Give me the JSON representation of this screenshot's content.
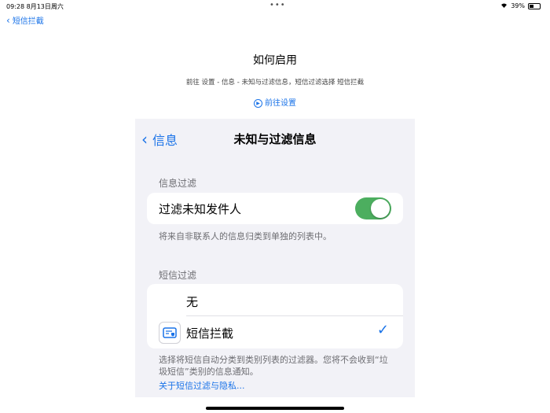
{
  "status_bar": {
    "time": "09:28",
    "date": "8月13日周六",
    "dots": "•••",
    "battery": "39%",
    "battery_level": 0.39
  },
  "back_link": {
    "label": "短信拦截"
  },
  "page": {
    "title": "如何启用",
    "path": "前往 设置 - 信息 - 未知与过滤信息，短信过滤选择 短信拦截",
    "goto_label": "前往设置",
    "goto_icon": "play-circle-icon"
  },
  "settings": {
    "nav_back": "信息",
    "nav_title": "未知与过滤信息",
    "section1_label": "信息过滤",
    "filter_unknown_label": "过滤未知发件人",
    "filter_unknown_on": true,
    "section1_footnote": "将来自非联系人的信息归类到单独的列表中。",
    "section2_label": "短信过滤",
    "option_none": "无",
    "option_app": "短信拦截",
    "section2_footnote": "选择将短信自动分类到类别列表的过滤器。您将不会收到“垃圾短信”类别的信息通知。",
    "privacy_link": "关于短信过滤与隐私...",
    "toggle_color": "#4cae5f",
    "accent": "#1a73e8"
  }
}
